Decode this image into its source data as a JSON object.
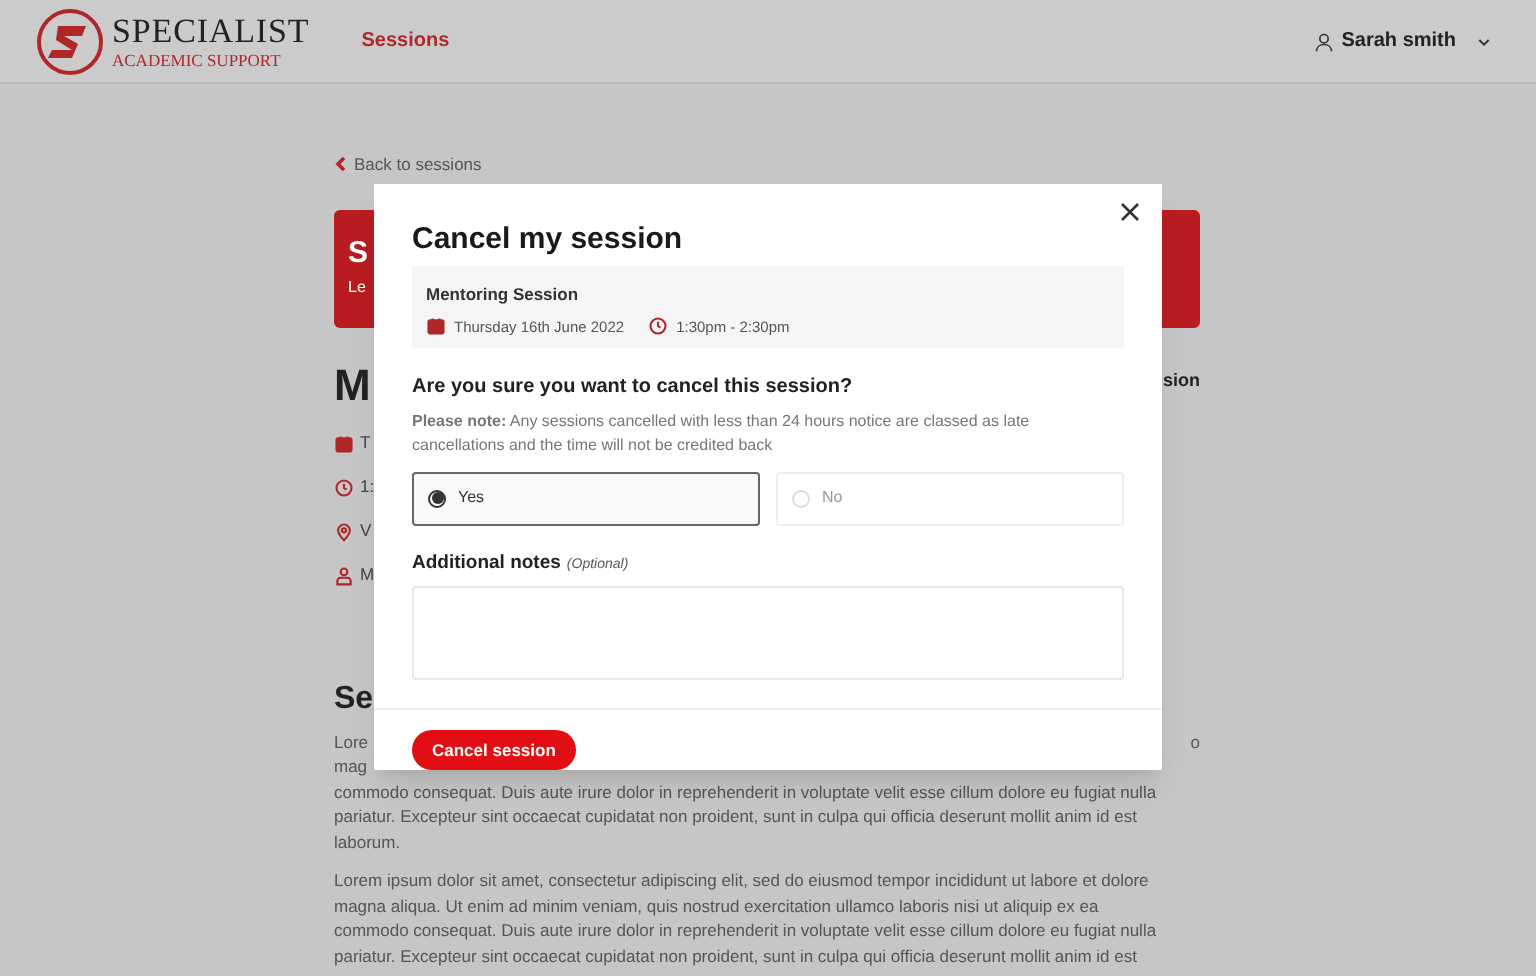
{
  "header": {
    "logo": {
      "title": "SPECIALIST",
      "subtitle": "ACADEMIC SUPPORT"
    },
    "nav": [
      {
        "label": "Sessions",
        "selected": true
      }
    ],
    "user": {
      "name": "Sarah smith"
    }
  },
  "page": {
    "back_link": "Back to sessions",
    "banner": {
      "title": "S",
      "subtitle": "Le"
    },
    "heading": "M",
    "side_link": "sion",
    "details": [
      {
        "kind": "date",
        "text": "T"
      },
      {
        "kind": "time",
        "text": "1:"
      },
      {
        "kind": "location",
        "text": "V"
      },
      {
        "kind": "person",
        "text": "M"
      }
    ],
    "section_heading": "Se",
    "paragraph_start": [
      {
        "left": "Lore",
        "right": "o"
      },
      {
        "left": "mag"
      }
    ],
    "paragraph_rest": [
      "commodo consequat. Duis aute irure dolor in reprehenderit in voluptate velit esse cillum dolore eu fugiat nulla",
      "pariatur. Excepteur sint occaecat cupidatat non proident, sunt in culpa qui officia deserunt mollit anim id est",
      "laborum."
    ],
    "paragraph_2": [
      "Lorem ipsum dolor sit amet, consectetur adipiscing elit, sed do eiusmod tempor incididunt ut labore et dolore",
      "magna aliqua. Ut enim ad minim veniam, quis nostrud exercitation ullamco laboris nisi ut aliquip ex ea",
      "commodo consequat. Duis aute irure dolor in reprehenderit in voluptate velit esse cillum dolore eu fugiat nulla",
      "pariatur. Excepteur sint occaecat cupidatat non proident, sunt in culpa qui officia deserunt mollit anim id est"
    ]
  },
  "modal": {
    "title": "Cancel my session",
    "session": {
      "name": "Mentoring Session",
      "date": "Thursday 16th June 2022",
      "time": "1:30pm - 2:30pm"
    },
    "question": "Are you sure you want to cancel this session?",
    "note": "**Please note:** Any sessions cancelled with less than 24 hours notice are classed as late cancellations and the time will not be credited back",
    "options": [
      {
        "label": "Yes",
        "selected": true
      },
      {
        "label": "No",
        "selected": false
      }
    ],
    "notes": {
      "label": "Additional notes",
      "hint": "(Optional)"
    },
    "button": "Cancel session"
  }
}
